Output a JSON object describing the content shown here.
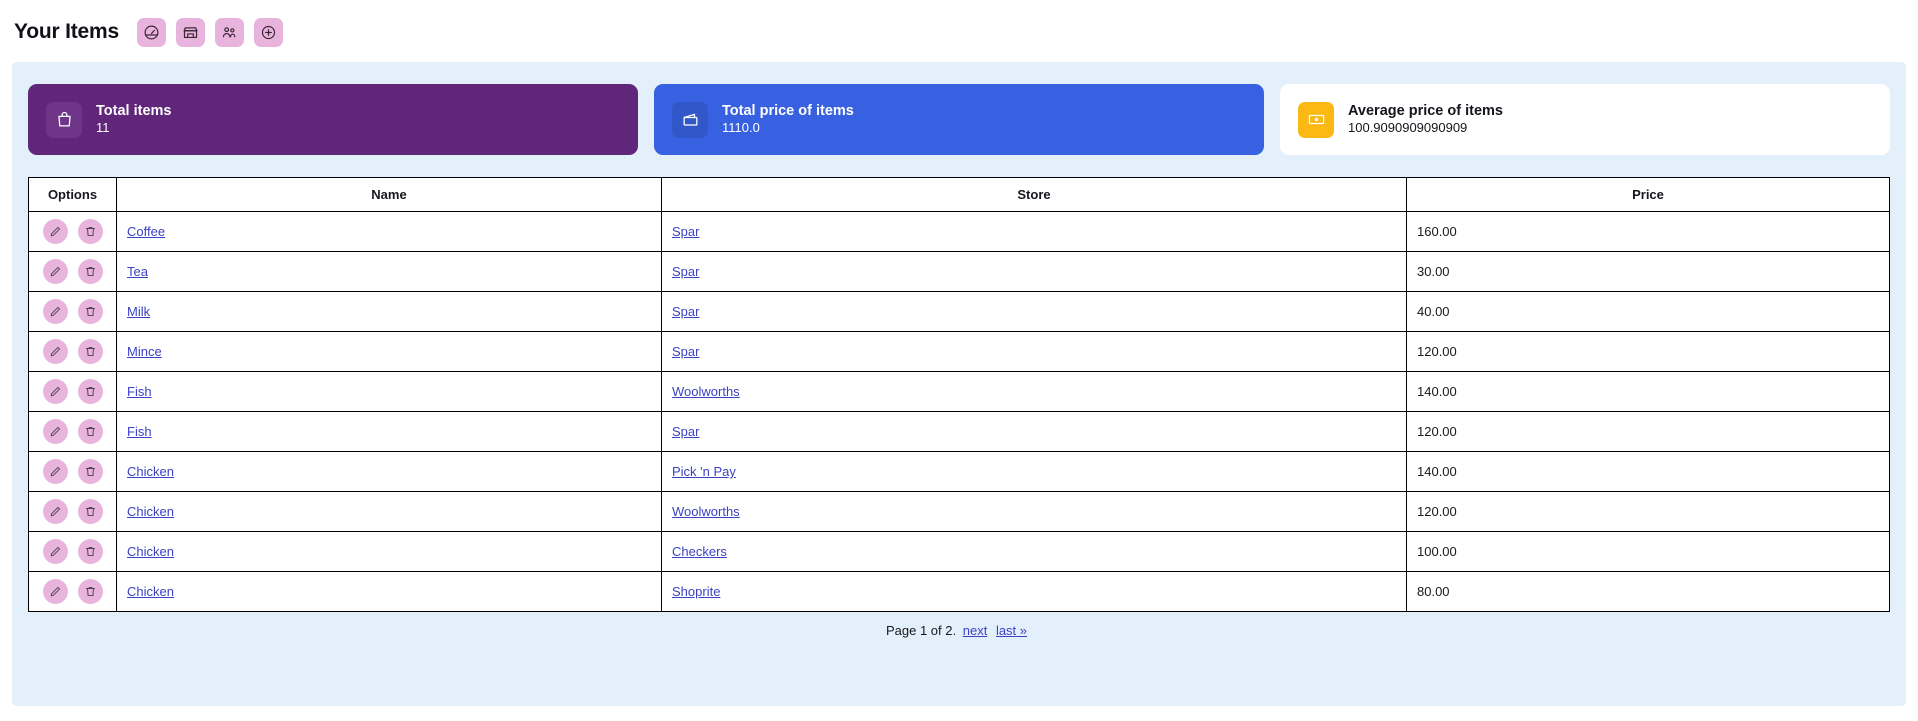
{
  "header": {
    "title": "Your Items",
    "nav_icons": [
      {
        "name": "dashboard-gauge-icon",
        "label": "Dashboard"
      },
      {
        "name": "store-icon",
        "label": "Stores"
      },
      {
        "name": "users-group-icon",
        "label": "Users"
      },
      {
        "name": "plus-circle-icon",
        "label": "Add item"
      }
    ]
  },
  "stats": [
    {
      "label": "Total items",
      "value": "11",
      "icon": "shopping-bag-icon",
      "card_color": "#5f2679",
      "icon_color": "#6f3589",
      "text_color": "#ffffff"
    },
    {
      "label": "Total price of items",
      "value": "1110.0",
      "icon": "wallet-icon",
      "card_color": "#3761e0",
      "icon_color": "#3257c9",
      "text_color": "#ffffff"
    },
    {
      "label": "Average price of items",
      "value": "100.9090909090909",
      "icon": "banknote-icon",
      "card_color": "#ffffff",
      "icon_color": "#fcb813",
      "text_color": "#14161c"
    }
  ],
  "table": {
    "columns": [
      "Options",
      "Name",
      "Store",
      "Price"
    ],
    "row_actions": [
      {
        "name": "edit-button",
        "icon": "pencil-icon"
      },
      {
        "name": "delete-button",
        "icon": "trash-icon"
      }
    ],
    "rows": [
      {
        "name": "Coffee",
        "store": "Spar",
        "price": "160.00"
      },
      {
        "name": "Tea",
        "store": "Spar",
        "price": "30.00"
      },
      {
        "name": "Milk",
        "store": "Spar",
        "price": "40.00"
      },
      {
        "name": "Mince",
        "store": "Spar",
        "price": "120.00"
      },
      {
        "name": "Fish",
        "store": "Woolworths",
        "price": "140.00"
      },
      {
        "name": "Fish",
        "store": "Spar",
        "price": "120.00"
      },
      {
        "name": "Chicken",
        "store": "Pick 'n Pay",
        "price": "140.00"
      },
      {
        "name": "Chicken",
        "store": "Woolworths",
        "price": "120.00"
      },
      {
        "name": "Chicken",
        "store": "Checkers",
        "price": "100.00"
      },
      {
        "name": "Chicken",
        "store": "Shoprite",
        "price": "80.00"
      }
    ]
  },
  "pagination": {
    "status": "Page 1 of 2.",
    "next_label": "next",
    "last_label": "last »"
  },
  "colors": {
    "panel_background": "#e3f0fb",
    "accent_pink": "#e8b4dd",
    "link": "#3b42c4"
  }
}
